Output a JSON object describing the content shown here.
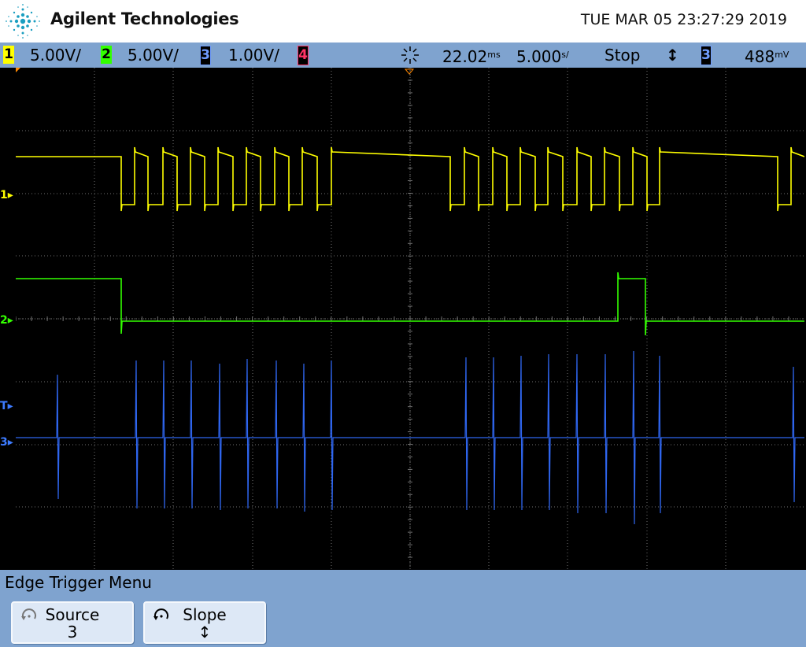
{
  "header": {
    "brand": "Agilent Technologies",
    "datetime": "TUE MAR 05 23:27:29 2019"
  },
  "statusbar": {
    "channels": [
      {
        "num": "1",
        "scale": "5.00V/",
        "color": "#ffff00"
      },
      {
        "num": "2",
        "scale": "5.00V/",
        "color": "#33ff00"
      },
      {
        "num": "3",
        "scale": "1.00V/",
        "color": "#3366ff"
      },
      {
        "num": "4",
        "scale": "",
        "color": "#ff3366"
      }
    ],
    "time_delay": "22.02",
    "time_delay_unit": "ms",
    "time_scale": "5.000",
    "time_scale_unit": "s/",
    "run_state": "Stop",
    "trigger_slope_symbol": "↕",
    "trigger_source": "3",
    "trigger_level": "488",
    "trigger_level_unit": "mV"
  },
  "markers": {
    "ch1": "1",
    "ch2": "2",
    "ch3": "3",
    "trigger": "T"
  },
  "menu": {
    "title": "Edge Trigger Menu",
    "softkeys": [
      {
        "label": "Source",
        "value": "3",
        "icon": "rotate-knob-icon"
      },
      {
        "label": "Slope",
        "value": "↕",
        "icon": "rotate-knob-icon"
      }
    ]
  },
  "colors": {
    "ch1": "#ffff00",
    "ch2": "#33ff00",
    "ch3": "#3366ff",
    "ch4": "#ff3366",
    "grid": "#7a7a7a",
    "screen": "#000000",
    "menu_bg": "#7fa3cf"
  }
}
